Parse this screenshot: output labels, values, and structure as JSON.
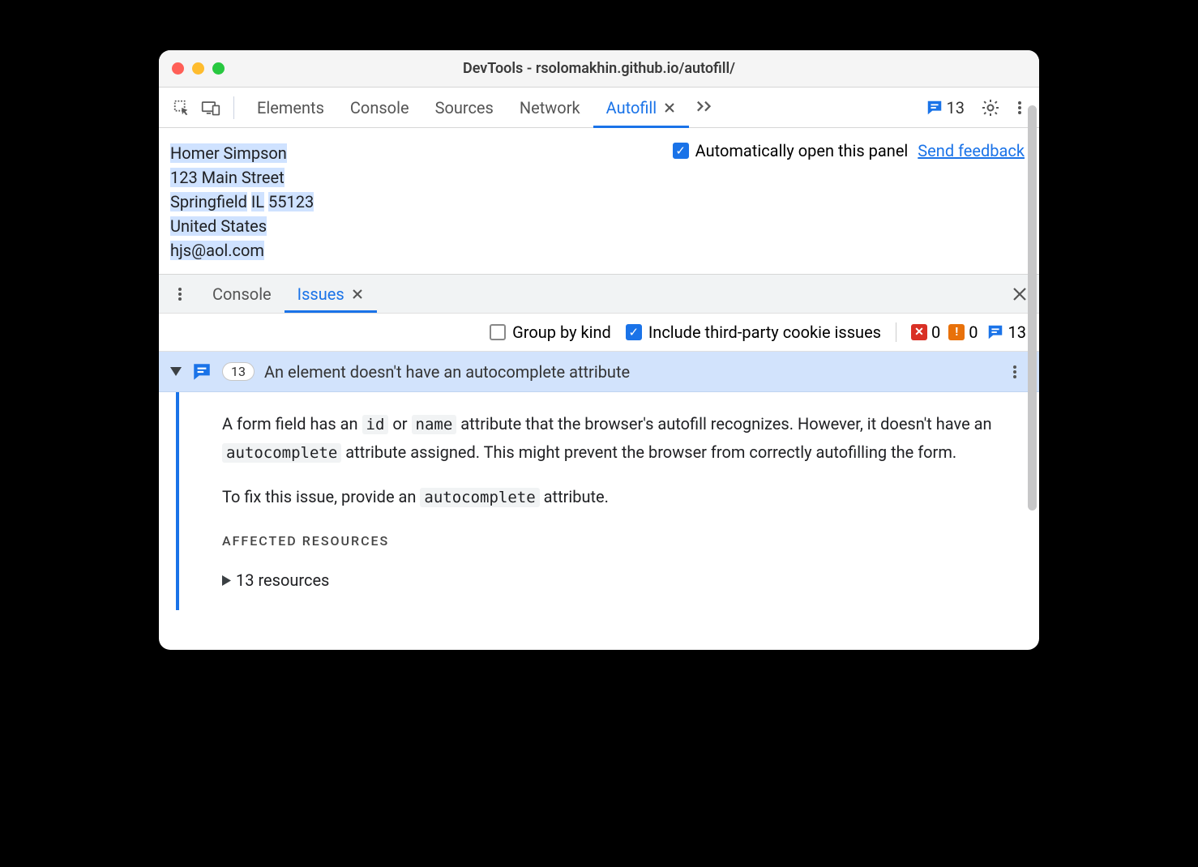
{
  "titlebar": {
    "title": "DevTools - rsolomakhin.github.io/autofill/"
  },
  "tabs": {
    "elements": "Elements",
    "console": "Console",
    "sources": "Sources",
    "network": "Network",
    "autofill": "Autofill"
  },
  "toolbar": {
    "issues_count": "13"
  },
  "autofill_panel": {
    "address": {
      "name": "Homer Simpson",
      "street": "123 Main Street",
      "city": "Springfield",
      "state": "IL",
      "zip": "55123",
      "country": "United States",
      "email": "hjs@aol.com"
    },
    "auto_open_label": "Automatically open this panel",
    "send_feedback": "Send feedback"
  },
  "drawer": {
    "tabs": {
      "console": "Console",
      "issues": "Issues"
    },
    "filter": {
      "group_by_kind": "Group by kind",
      "include_3p": "Include third-party cookie issues",
      "counts": {
        "errors": "0",
        "warnings": "0",
        "info": "13"
      }
    }
  },
  "issue": {
    "count_badge": "13",
    "title": "An element doesn't have an autocomplete attribute",
    "p1_pre": "A form field has an ",
    "p1_code1": "id",
    "p1_mid1": " or ",
    "p1_code2": "name",
    "p1_mid2": " attribute that the browser's autofill recognizes. However, it doesn't have an ",
    "p1_code3": "autocomplete",
    "p1_post": " attribute assigned. This might prevent the browser from correctly autofilling the form.",
    "p2_pre": "To fix this issue, provide an ",
    "p2_code": "autocomplete",
    "p2_post": " attribute.",
    "affected_title": "AFFECTED RESOURCES",
    "resources_text": "13 resources"
  }
}
